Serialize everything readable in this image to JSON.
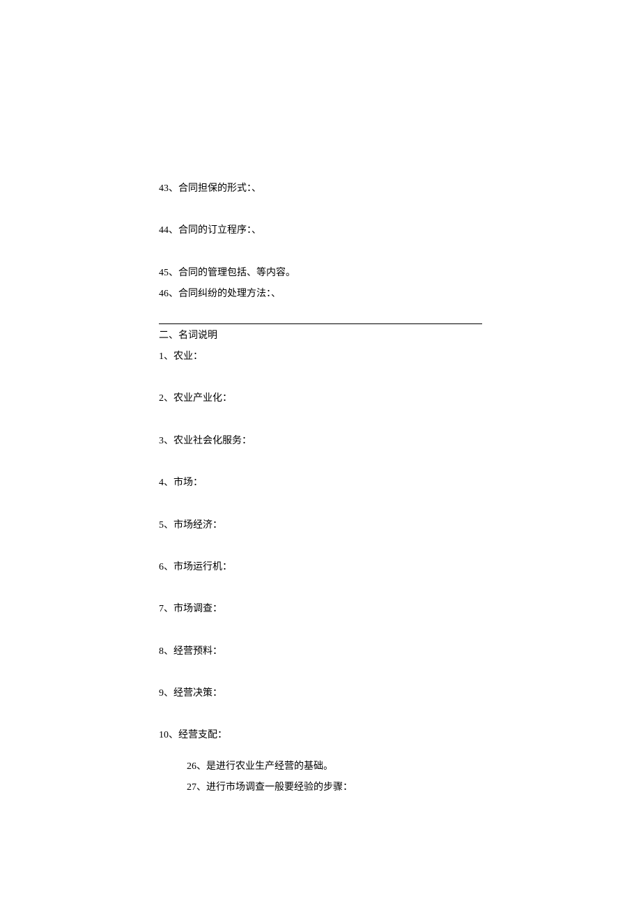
{
  "section1": {
    "items": [
      "43、合同担保的形式：、",
      "44、合同的订立程序：、",
      "45、合同的管理包括、等内容。",
      "46、合同纠纷的处理方法：、"
    ]
  },
  "section2": {
    "title": "二、名词说明",
    "items": [
      "1、农业：",
      "2、农业产业化：",
      "3、农业社会化服务：",
      "4、市场：",
      "5、市场经济：",
      "6、市场运行机：",
      "7、市场调查：",
      "8、经营预料：",
      "9、经营决策：",
      "10、经营支配："
    ]
  },
  "section3": {
    "items": [
      "26、是进行农业生产经营的基础。",
      "27、进行市场调查一般要经验的步骤："
    ]
  }
}
